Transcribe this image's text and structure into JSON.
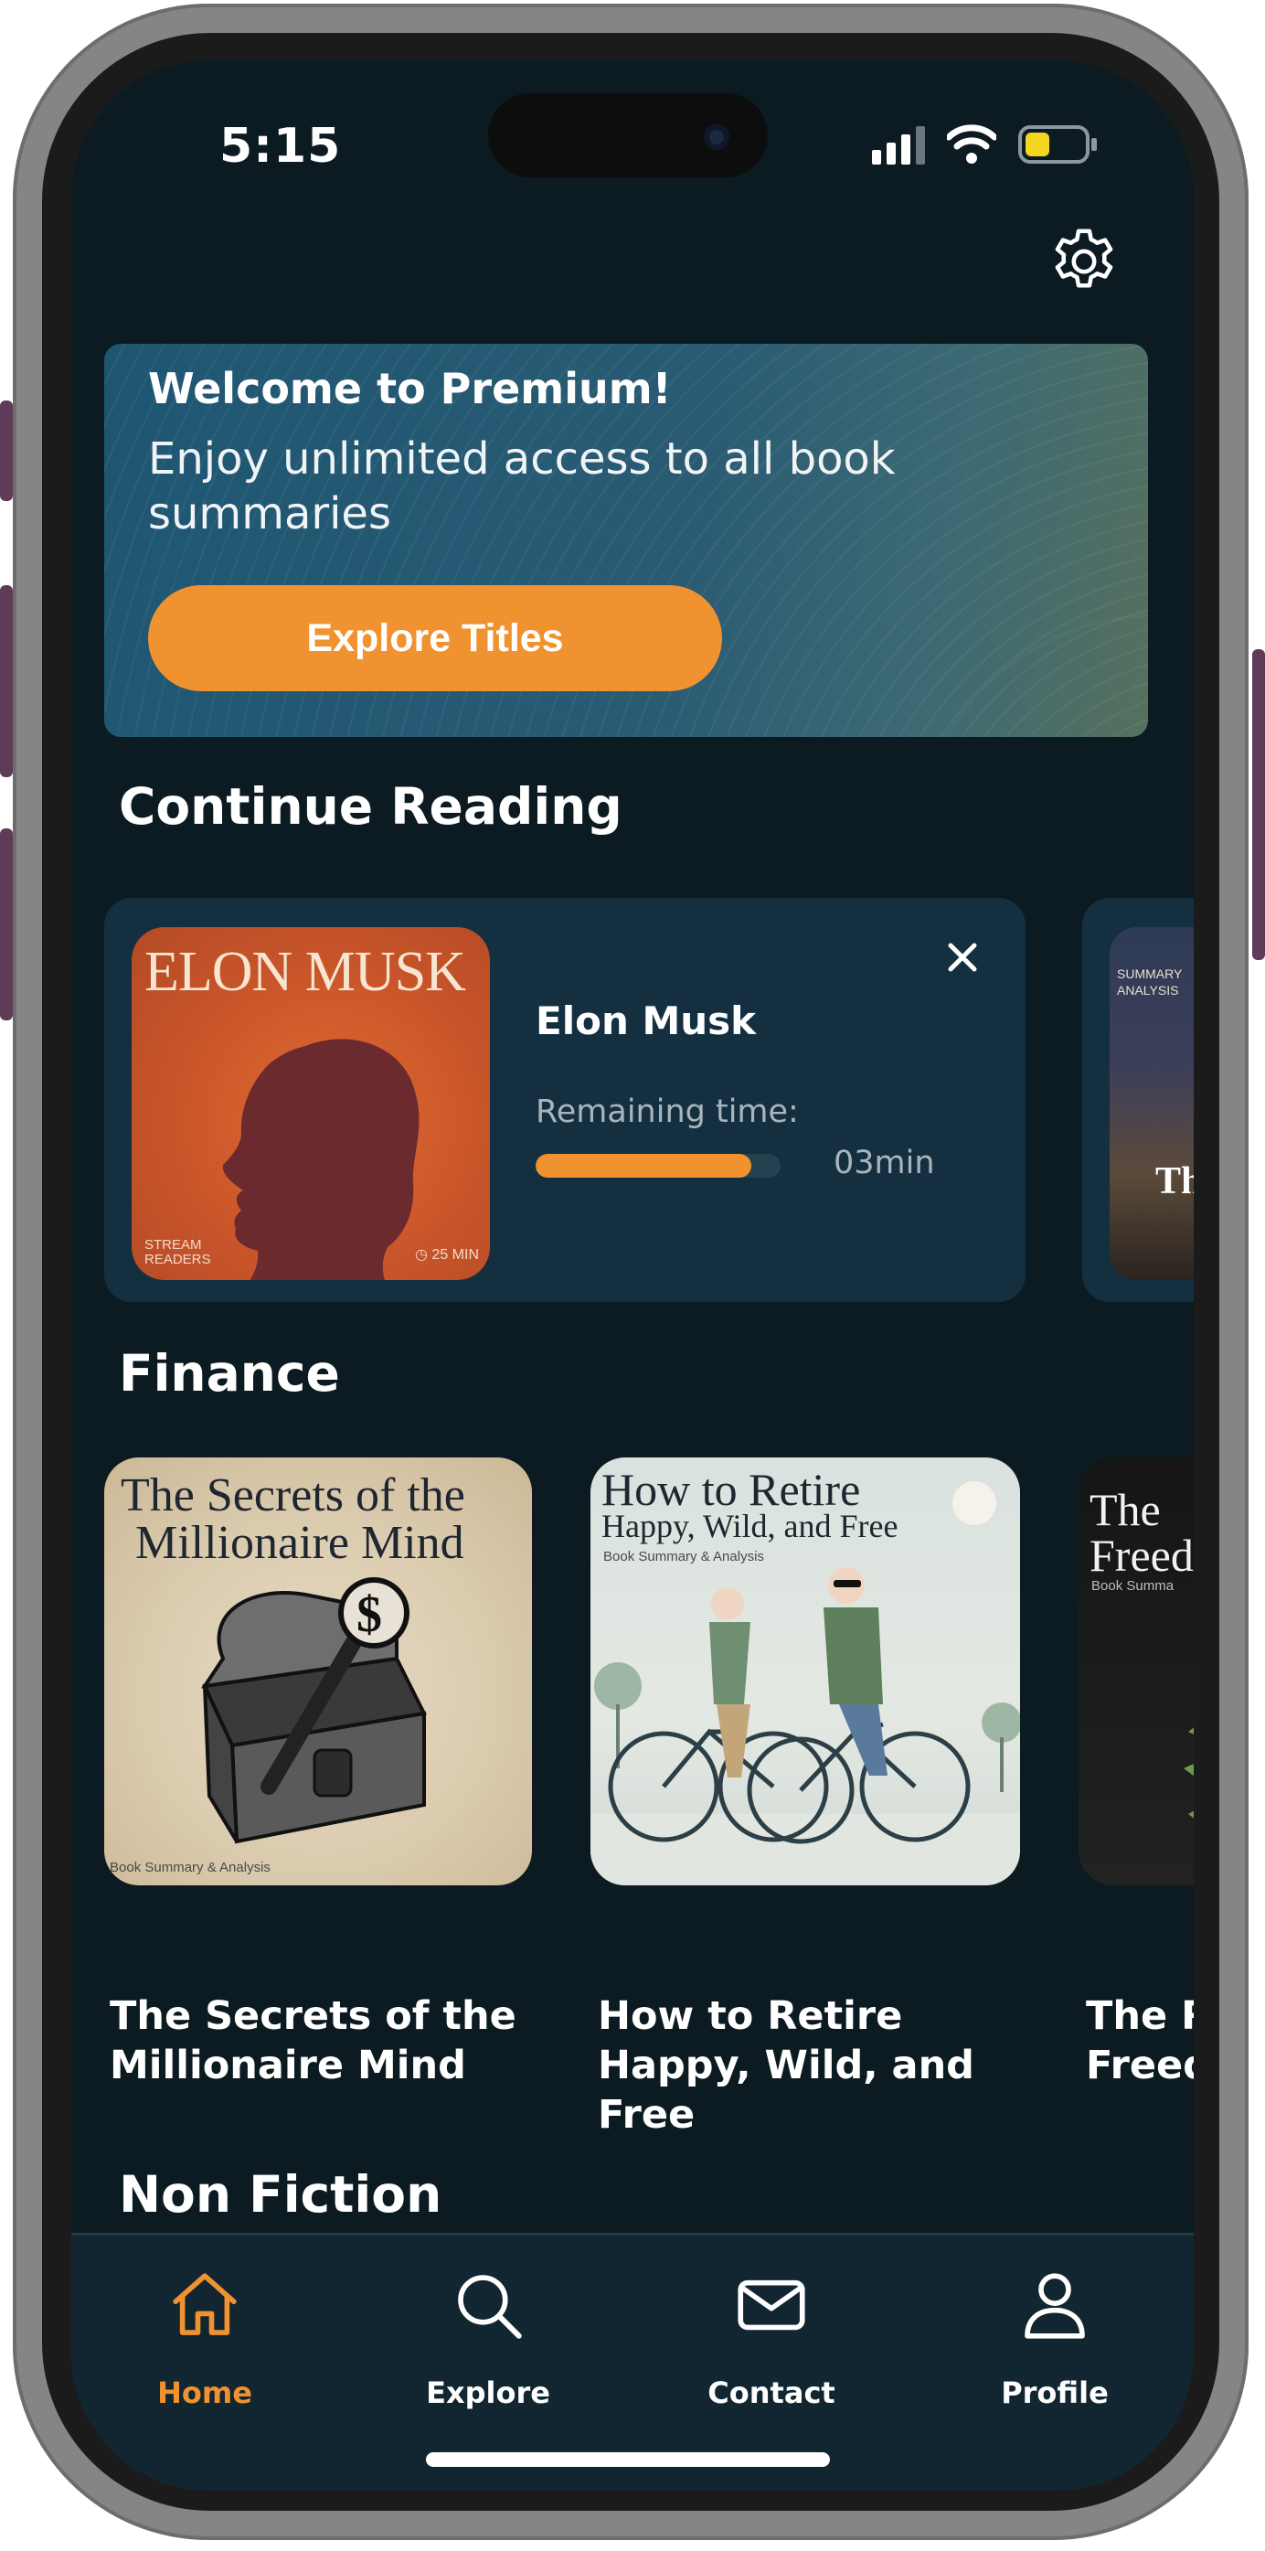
{
  "status_bar": {
    "time": "5:15"
  },
  "banner": {
    "title": "Welcome to Premium!",
    "subtitle": "Enjoy unlimited access to all book summaries",
    "cta_label": "Explore Titles"
  },
  "continue_reading": {
    "section_title": "Continue Reading",
    "current": {
      "title": "Elon Musk",
      "cover_title": "ELON MUSK",
      "cover_brand": "STREAM READERS",
      "cover_duration": "25 MIN",
      "remaining_label": "Remaining time:",
      "remaining_value": "03min",
      "progress": 0.88
    },
    "next_peek": {
      "cover_text": "SUMMARY ANALYSIS",
      "cover_big": "Th"
    }
  },
  "finance": {
    "section_title": "Finance",
    "books": [
      {
        "title": "The Secrets of the Millionaire Mind",
        "cover_line1": "The Secrets of the",
        "cover_line2": "Millionaire Mind",
        "cover_tag": "Book Summary & Analysis"
      },
      {
        "title": "How to Retire Happy, Wild, and Free",
        "cover_line1": "How to Retire",
        "cover_line2": "Happy, Wild, and Free",
        "cover_tag": "Book Summary & Analysis"
      },
      {
        "title": "The R Freed",
        "cover_line1": "The",
        "cover_line2": "Freed",
        "cover_tag": "Book Summa"
      }
    ]
  },
  "non_fiction": {
    "section_title": "Non Fiction"
  },
  "bottom_nav": {
    "items": [
      {
        "label": "Home",
        "icon": "home-icon",
        "active": true
      },
      {
        "label": "Explore",
        "icon": "search-icon",
        "active": false
      },
      {
        "label": "Contact",
        "icon": "mail-icon",
        "active": false
      },
      {
        "label": "Profile",
        "icon": "user-icon",
        "active": false
      }
    ]
  },
  "colors": {
    "accent": "#f0922f",
    "background": "#0b1b21",
    "card": "#143040",
    "nav": "#122632"
  }
}
